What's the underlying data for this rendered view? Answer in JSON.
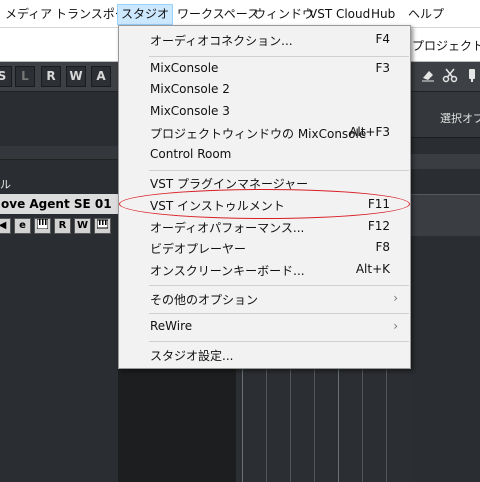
{
  "menubar": {
    "items": [
      {
        "label": "メディア"
      },
      {
        "label": "トランスポート"
      },
      {
        "label": "スタジオ"
      },
      {
        "label": "ワークスペース"
      },
      {
        "label": "ウィンドウ"
      },
      {
        "label": "VST Cloud"
      },
      {
        "label": "Hub"
      },
      {
        "label": "ヘルプ"
      }
    ],
    "active_index": 2
  },
  "window": {
    "project_title": "プロジェクト - ‹"
  },
  "toolbar": {
    "buttons": [
      "S",
      "L",
      "R",
      "W",
      "A"
    ]
  },
  "right_panel": {
    "header": "選択オブ"
  },
  "track": {
    "label_partial": "ル",
    "instrument_name": "ove Agent SE 01",
    "buttons": [
      "e",
      "R",
      "W"
    ]
  },
  "studio_menu": {
    "items": [
      {
        "label": "オーディオコネクション...",
        "shortcut": "F4"
      },
      {
        "label": "MixConsole",
        "shortcut": "F3"
      },
      {
        "label": "MixConsole 2",
        "shortcut": ""
      },
      {
        "label": "MixConsole 3",
        "shortcut": ""
      },
      {
        "label": "プロジェクトウィンドウの MixConsole",
        "shortcut": "Alt+F3"
      },
      {
        "label": "Control Room",
        "shortcut": ""
      },
      {
        "label": "VST プラグインマネージャー",
        "shortcut": ""
      },
      {
        "label": "VST インストゥルメント",
        "shortcut": "F11"
      },
      {
        "label": "オーディオパフォーマンス...",
        "shortcut": "F12"
      },
      {
        "label": "ビデオプレーヤー",
        "shortcut": "F8"
      },
      {
        "label": "オンスクリーンキーボード...",
        "shortcut": "Alt+K"
      },
      {
        "label": "その他のオプション",
        "submenu_arrow": "›"
      },
      {
        "label": "ReWire",
        "submenu_arrow": "›"
      },
      {
        "label": "スタジオ設定...",
        "shortcut": ""
      }
    ],
    "highlighted_label": "VST インストゥルメント"
  },
  "colors": {
    "menu_active_bg": "#cce8ff",
    "annotation_red": "#d81f26",
    "daw_dark": "#2a2d31"
  }
}
